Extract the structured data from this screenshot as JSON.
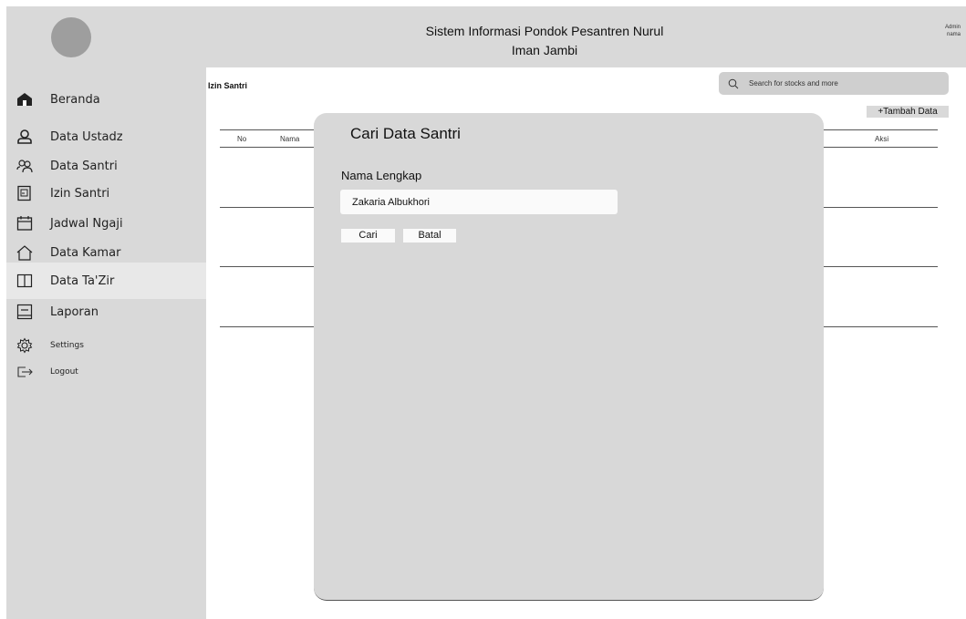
{
  "header": {
    "title_line1": "Sistem Informasi Pondok Pesantren Nurul",
    "title_line2": "Iman Jambi",
    "admin_line1": "Admin",
    "admin_line2": "nama"
  },
  "sidebar": {
    "items": [
      {
        "label": "Beranda",
        "icon": "home-icon"
      },
      {
        "label": "Data Ustadz",
        "icon": "user-icon"
      },
      {
        "label": "Data Santri",
        "icon": "users-icon"
      },
      {
        "label": "Izin Santri",
        "icon": "document-icon"
      },
      {
        "label": "Jadwal Ngaji",
        "icon": "calendar-icon"
      },
      {
        "label": "Data Kamar",
        "icon": "house-outline-icon"
      },
      {
        "label": "Data Ta'Zir",
        "icon": "book-icon"
      },
      {
        "label": "Laporan",
        "icon": "report-icon"
      },
      {
        "label": "Settings",
        "icon": "gear-icon"
      },
      {
        "label": "Logout",
        "icon": "logout-icon"
      }
    ],
    "active_index": 6
  },
  "main": {
    "page_title": "Izin Santri",
    "search_placeholder": "Search for stocks and more",
    "add_button": "+Tambah Data",
    "table_headers": [
      "No",
      "Nama",
      "Aksi"
    ]
  },
  "modal": {
    "title": "Cari Data Santri",
    "field_label": "Nama Lengkap",
    "field_value": "Zakaria Albukhori",
    "search_button": "Cari",
    "cancel_button": "Batal"
  }
}
